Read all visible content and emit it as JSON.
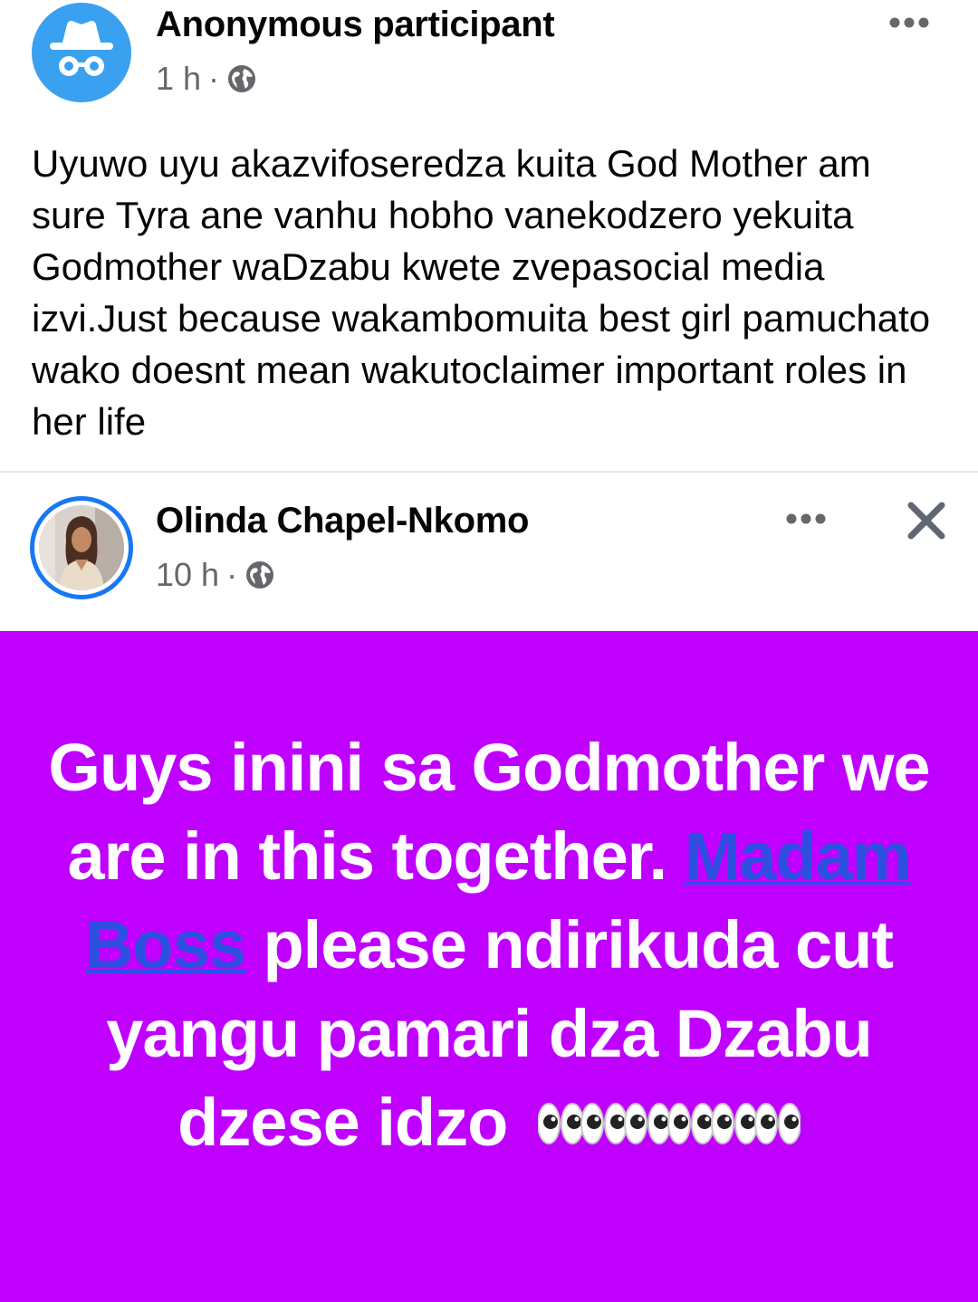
{
  "post": {
    "author": "Anonymous participant",
    "time": "1 h",
    "separator": "·",
    "privacy_icon": "globe-icon",
    "more_icon": "more-dots-icon",
    "text": "Uyuwo uyu akazvifoseredza kuita God Mother am sure Tyra ane vanhu hobho vanekodzero yekuita Godmother waDzabu kwete zvepasocial media izvi.Just because wakambomuita best girl pamuchato wako doesnt mean wakutoclaimer important roles in her life"
  },
  "shared_post": {
    "author": "Olinda Chapel-Nkomo",
    "time": "10 h",
    "separator": "·",
    "privacy_icon": "globe-icon",
    "more_icon": "more-dots-icon",
    "close_icon": "close-icon",
    "background_color": "#c000ff",
    "text_part1": "Guys inini sa Godmother we are in this together.",
    "mention": "Madam Boss",
    "text_part2": "please ndirikuda cut yangu pamari dza Dzabu dzese idzo",
    "emoji_icon": "eyes-emoji-icon",
    "emoji_count": 6
  }
}
